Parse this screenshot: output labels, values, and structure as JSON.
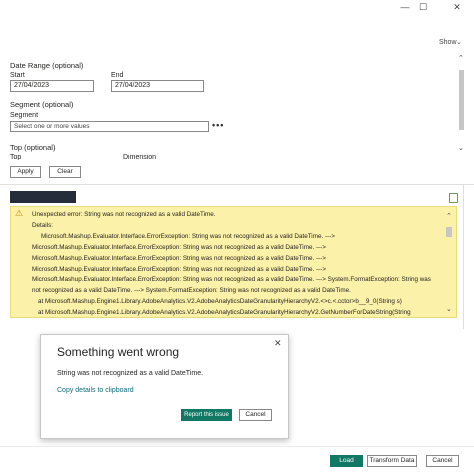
{
  "window": {
    "minimize_glyph": "—",
    "maximize_glyph": "☐",
    "close_glyph": "✕"
  },
  "toolbar": {
    "show_label": "Show",
    "show_chevron": "⌄"
  },
  "options": {
    "date_range_label": "Date Range (optional)",
    "start_label": "Start",
    "start_value": "27/04/2023",
    "end_label": "End",
    "end_value": "27/04/2023",
    "segment_section_label": "Segment (optional)",
    "segment_label": "Segment",
    "segment_placeholder": "Select one or more values",
    "segment_more": "•••",
    "top_section_label": "Top (optional)",
    "top_label": "Top",
    "dimension_label": "Dimension",
    "apply_label": "Apply",
    "clear_label": "Clear",
    "scroll_up": "⌃",
    "scroll_down": "⌄"
  },
  "error": {
    "warning_glyph": "⚠",
    "lines": [
      "Unexpected error: String was not recognized as a valid DateTime.",
      "Details:",
      "Microsoft.Mashup.Evaluator.Interface.ErrorException: String was not recognized as a valid DateTime. --->",
      "Microsoft.Mashup.Evaluator.Interface.ErrorException: String was not recognized as a valid DateTime. --->",
      "Microsoft.Mashup.Evaluator.Interface.ErrorException: String was not recognized as a valid DateTime. --->",
      "Microsoft.Mashup.Evaluator.Interface.ErrorException: String was not recognized as a valid DateTime. --->",
      "Microsoft.Mashup.Evaluator.Interface.ErrorException: String was not recognized as a valid DateTime. ---> System.FormatException: String was",
      "not recognized as a valid DateTime. ---> System.FormatException: String was not recognized as a valid DateTime.",
      "at Microsoft.Mashup.Engine1.Library.AdobeAnalytics.V2.AdobeAnalyticsDateGranularityHierarchyV2.<>c.<.cctor>b__9_0(String s)",
      "at Microsoft.Mashup.Engine1.Library.AdobeAnalytics.V2.AdobeAnalyticsDateGranularityHierarchyV2.GetNumberForDateString(String"
    ],
    "scroll_up": "⌃",
    "scroll_down": "⌄"
  },
  "dialog": {
    "title": "Something went wrong",
    "close_glyph": "✕",
    "message": "String was not recognized as a valid DateTime.",
    "copy_link": "Copy details to clipboard",
    "report_label": "Report this issue",
    "cancel_label": "Cancel"
  },
  "footer": {
    "load_label": "Load",
    "transform_label": "Transform Data",
    "cancel_label": "Cancel"
  },
  "colors": {
    "error_bg": "#fbf1a8",
    "primary": "#117865",
    "link": "#116b7a"
  }
}
